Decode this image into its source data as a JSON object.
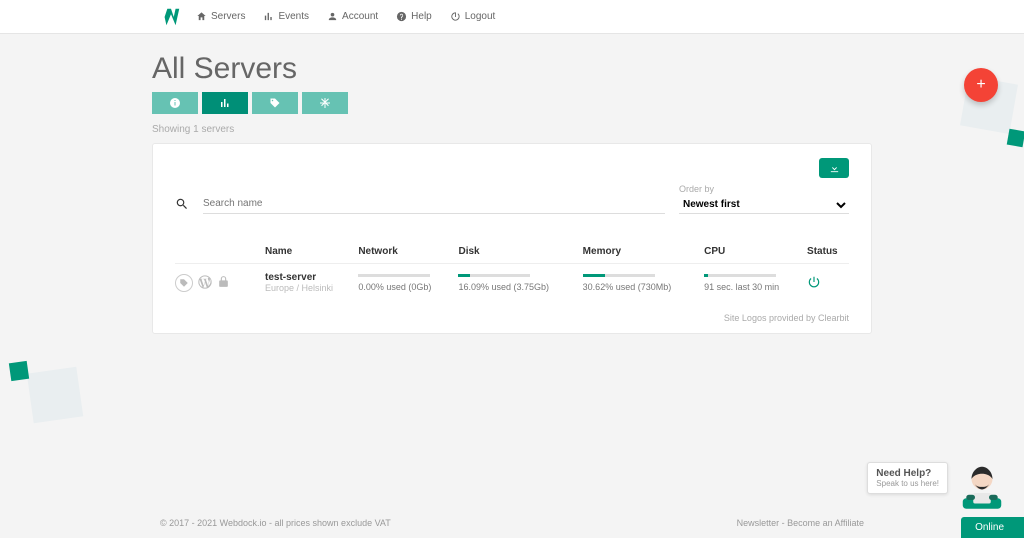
{
  "nav": {
    "servers": "Servers",
    "events": "Events",
    "account": "Account",
    "help": "Help",
    "logout": "Logout"
  },
  "page": {
    "title": "All Servers",
    "showing": "Showing 1 servers"
  },
  "filters": {
    "search_placeholder": "Search name",
    "order_label": "Order by",
    "order_value": "Newest first"
  },
  "columns": {
    "name": "Name",
    "network": "Network",
    "disk": "Disk",
    "memory": "Memory",
    "cpu": "CPU",
    "status": "Status"
  },
  "server": {
    "name": "test-server",
    "location": "Europe / Helsinki",
    "network": "0.00% used (0Gb)",
    "network_pct": 0,
    "disk": "16.09% used (3.75Gb)",
    "disk_pct": 16,
    "memory": "30.62% used (730Mb)",
    "memory_pct": 31,
    "cpu": "91 sec. last 30 min",
    "cpu_pct": 5
  },
  "clearbit": "Site Logos provided by Clearbit",
  "footer": {
    "left": "© 2017 - 2021 Webdock.io - all prices shown exclude VAT",
    "right": "Newsletter - Become an Affiliate"
  },
  "support": {
    "title": "Need Help?",
    "sub": "Speak to us here!",
    "status": "Online"
  }
}
